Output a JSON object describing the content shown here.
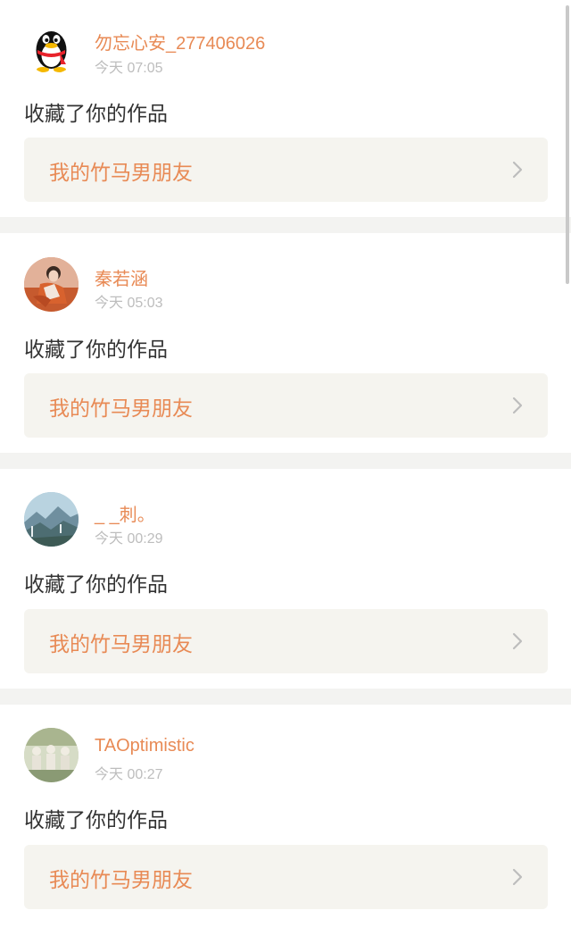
{
  "colors": {
    "accent": "#e88a55",
    "time": "#bdbdbd",
    "action": "#333333",
    "box": "#f5f4ef",
    "separator": "#f3f3f1"
  },
  "notifications": [
    {
      "user": "勿忘心安_277406026",
      "time": "今天 07:05",
      "action": "收藏了你的作品",
      "work": "我的竹马男朋友",
      "avatar_icon": "qq-penguin-avatar"
    },
    {
      "user": "秦若涵",
      "time": "今天 05:03",
      "action": "收藏了你的作品",
      "work": "我的竹马男朋友",
      "avatar_icon": "person-photo-avatar"
    },
    {
      "user": "_ _刺。",
      "time": "今天 00:29",
      "action": "收藏了你的作品",
      "work": "我的竹马男朋友",
      "avatar_icon": "mountain-landscape-avatar"
    },
    {
      "user": "TAOptimistic",
      "time": "今天 00:27",
      "action": "收藏了你的作品",
      "work": "我的竹马男朋友",
      "avatar_icon": "group-photo-avatar"
    }
  ]
}
